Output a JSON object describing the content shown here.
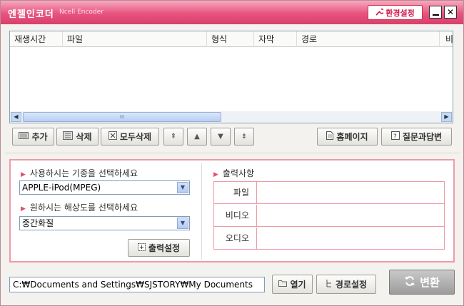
{
  "app": {
    "title": "엔젤인코더",
    "subtitle": "Ncell Encoder",
    "settings_label": "환경설정",
    "close_glyph": "✕"
  },
  "file_list": {
    "columns": [
      "재생시간",
      "파일",
      "형식",
      "자막",
      "경로",
      "비"
    ],
    "rows": [],
    "scroll_left": "◀",
    "scroll_right": "▶",
    "scroll_thumb": "III"
  },
  "toolbar": {
    "add": "추가",
    "delete": "삭제",
    "delete_all": "모두삭제",
    "move_top": "⇞",
    "move_up": "▲",
    "move_down": "▼",
    "move_bottom": "⇟",
    "homepage": "홈페이지",
    "faq": "질문과답변"
  },
  "device_panel": {
    "device_label": "사용하시는 기종을 선택하세요",
    "device_value": "APPLE-iPod(MPEG)",
    "resolution_label": "원하시는 해상도를 선택하세요",
    "resolution_value": "중간화질",
    "output_settings": "출력설정"
  },
  "output_info": {
    "title": "출력사항",
    "rows": [
      {
        "label": "파일",
        "value": ""
      },
      {
        "label": "비디오",
        "value": ""
      },
      {
        "label": "오디오",
        "value": ""
      }
    ]
  },
  "bottom": {
    "path_value": "C:₩Documents and Settings₩SJSTORY₩My Documents",
    "open": "열기",
    "path_settings": "경로설정",
    "convert": "변환"
  },
  "colors": {
    "title_bar": "#e8537f",
    "accent_pink": "#ef9aa8",
    "convert_gray": "#9c9c9c"
  }
}
